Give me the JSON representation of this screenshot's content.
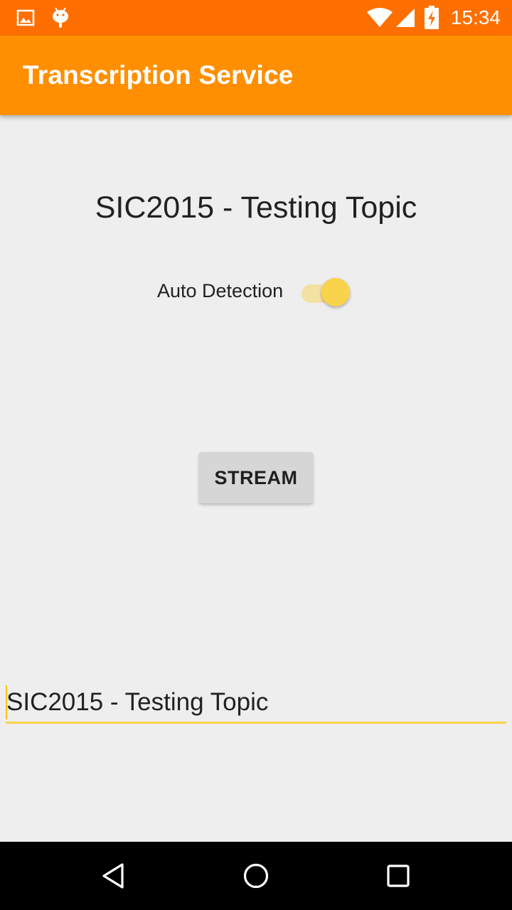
{
  "status_bar": {
    "time": "15:34",
    "background": "#ff6f00",
    "icons": [
      "image-icon",
      "android-icon",
      "wifi-icon",
      "signal-icon",
      "battery-charging-icon"
    ]
  },
  "app_bar": {
    "title": "Transcription Service",
    "background": "#ff8f00"
  },
  "main": {
    "topic_title": "SIC2015 - Testing Topic",
    "auto_detection": {
      "label": "Auto Detection",
      "enabled": true,
      "accent": "#f9d34b"
    },
    "stream_button_label": "STREAM",
    "topic_input_value": "SIC2015 - Testing Topic"
  },
  "nav_bar": {
    "buttons": [
      "back-icon",
      "home-icon",
      "recents-icon"
    ]
  }
}
